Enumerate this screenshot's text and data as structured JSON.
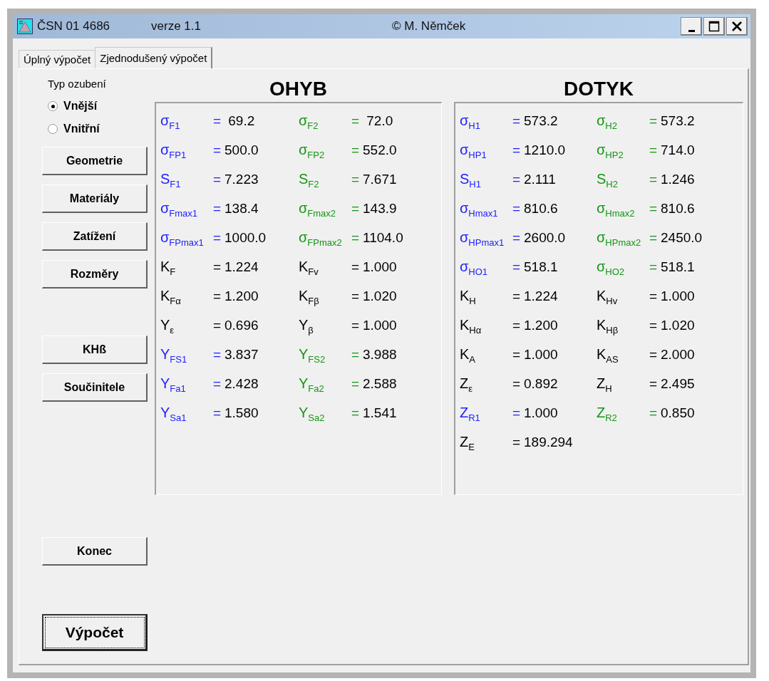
{
  "window": {
    "title": "ČSN 01 4686",
    "version": "verze 1.1",
    "author": "©  M. Němček"
  },
  "tabs": [
    {
      "label": "Úplný výpočet",
      "selected": false
    },
    {
      "label": "Zjednodušený výpočet",
      "selected": true
    }
  ],
  "gear_type": {
    "label": "Typ ozubení",
    "options": [
      {
        "label": "Vnější",
        "selected": true
      },
      {
        "label": "Vnitřní",
        "selected": false
      }
    ]
  },
  "buttons": [
    {
      "label": "Geometrie",
      "kind": "normal"
    },
    {
      "label": "Materiály",
      "kind": "normal"
    },
    {
      "label": "Zatížení",
      "kind": "normal"
    },
    {
      "label": "Rozměry",
      "kind": "normal"
    },
    {
      "label": "KHß",
      "kind": "gap"
    },
    {
      "label": "Součinitele",
      "kind": "normal"
    },
    {
      "label": "Konec",
      "kind": "far"
    },
    {
      "label": "Výpočet",
      "kind": "default"
    }
  ],
  "panels": [
    {
      "title": "OHYB",
      "rows": [
        {
          "left": {
            "label": "σ$_{F1}$",
            "eq": "=",
            "value": " 69.2",
            "color": "#2020ff"
          },
          "right": {
            "label": "σ$_{F2}$",
            "eq": "=",
            "value": " 72.0",
            "color": "#149614"
          }
        },
        {
          "left": {
            "label": "σ$_{FP1}$",
            "eq": "=",
            "value": "500.0",
            "color": "#2020ff"
          },
          "right": {
            "label": "σ$_{FP2}$",
            "eq": "=",
            "value": "552.0",
            "color": "#149614"
          }
        },
        {
          "left": {
            "label": "S$_{F1}$",
            "eq": "=",
            "value": "7.223",
            "color": "#2020ff"
          },
          "right": {
            "label": "S$_{F2}$",
            "eq": "=",
            "value": "7.671",
            "color": "#149614"
          }
        },
        {
          "left": {
            "label": "σ$_{Fmax1}$",
            "eq": "=",
            "value": "138.4",
            "color": "#2020ff"
          },
          "right": {
            "label": "σ$_{Fmax2}$",
            "eq": "=",
            "value": "143.9",
            "color": "#149614"
          }
        },
        {
          "left": {
            "label": "σ$_{FPmax1}$",
            "eq": "=",
            "value": "1000.0",
            "color": "#2020ff"
          },
          "right": {
            "label": "σ$_{FPmax2}$",
            "eq": "=",
            "value": "1104.0",
            "color": "#149614"
          }
        },
        {
          "left": {
            "label": "K$_{F}$",
            "eq": "=",
            "value": "1.224",
            "color": "#000000"
          },
          "right": {
            "label": "K$_{Fv}$",
            "eq": "=",
            "value": "1.000",
            "color": "#000000"
          }
        },
        {
          "left": {
            "label": "K$_{Fα}$",
            "eq": "=",
            "value": "1.200",
            "color": "#000000"
          },
          "right": {
            "label": "K$_{Fβ}$",
            "eq": "=",
            "value": "1.020",
            "color": "#000000"
          }
        },
        {
          "left": {
            "label": "Y$_{ε}$",
            "eq": "=",
            "value": "0.696",
            "color": "#000000"
          },
          "right": {
            "label": "Y$_{β}$",
            "eq": "=",
            "value": "1.000",
            "color": "#000000"
          }
        },
        {
          "left": {
            "label": "Y$_{FS1}$",
            "eq": "=",
            "value": "3.837",
            "color": "#2020ff"
          },
          "right": {
            "label": "Y$_{FS2}$",
            "eq": "=",
            "value": "3.988",
            "color": "#149614"
          }
        },
        {
          "left": {
            "label": "Y$_{Fa1}$",
            "eq": "=",
            "value": "2.428",
            "color": "#2020ff"
          },
          "right": {
            "label": "Y$_{Fa2}$",
            "eq": "=",
            "value": "2.588",
            "color": "#149614"
          }
        },
        {
          "left": {
            "label": "Y$_{Sa1}$",
            "eq": "=",
            "value": "1.580",
            "color": "#2020ff"
          },
          "right": {
            "label": "Y$_{Sa2}$",
            "eq": "=",
            "value": "1.541",
            "color": "#149614"
          }
        }
      ]
    },
    {
      "title": "DOTYK",
      "rows": [
        {
          "left": {
            "label": "σ$_{H1}$",
            "eq": "=",
            "value": "573.2",
            "color": "#2020ff"
          },
          "right": {
            "label": "σ$_{H2}$",
            "eq": "=",
            "value": "573.2",
            "color": "#149614"
          }
        },
        {
          "left": {
            "label": "σ$_{HP1}$",
            "eq": "=",
            "value": "1210.0",
            "color": "#2020ff"
          },
          "right": {
            "label": "σ$_{HP2}$",
            "eq": "=",
            "value": "714.0",
            "color": "#149614"
          }
        },
        {
          "left": {
            "label": "S$_{H1}$",
            "eq": "=",
            "value": "2.111",
            "color": "#2020ff"
          },
          "right": {
            "label": "S$_{H2}$",
            "eq": "=",
            "value": "1.246",
            "color": "#149614"
          }
        },
        {
          "left": {
            "label": "σ$_{Hmax1}$",
            "eq": "=",
            "value": "810.6",
            "color": "#2020ff"
          },
          "right": {
            "label": "σ$_{Hmax2}$",
            "eq": "=",
            "value": "810.6",
            "color": "#149614"
          }
        },
        {
          "left": {
            "label": "σ$_{HPmax1}$",
            "eq": "=",
            "value": "2600.0",
            "color": "#2020ff"
          },
          "right": {
            "label": "σ$_{HPmax2}$",
            "eq": "=",
            "value": "2450.0",
            "color": "#149614"
          }
        },
        {
          "left": {
            "label": "σ$_{HO1}$",
            "eq": "=",
            "value": "518.1",
            "color": "#2020ff"
          },
          "right": {
            "label": "σ$_{HO2}$",
            "eq": "=",
            "value": "518.1",
            "color": "#149614"
          }
        },
        {
          "left": {
            "label": "K$_{H}$",
            "eq": "=",
            "value": "1.224",
            "color": "#000000"
          },
          "right": {
            "label": "K$_{Hv}$",
            "eq": "=",
            "value": "1.000",
            "color": "#000000"
          }
        },
        {
          "left": {
            "label": "K$_{Hα}$",
            "eq": "=",
            "value": "1.200",
            "color": "#000000"
          },
          "right": {
            "label": "K$_{Hβ}$",
            "eq": "=",
            "value": "1.020",
            "color": "#000000"
          }
        },
        {
          "left": {
            "label": "K$_{A}$",
            "eq": "=",
            "value": "1.000",
            "color": "#000000"
          },
          "right": {
            "label": "K$_{AS}$",
            "eq": "=",
            "value": "2.000",
            "color": "#000000"
          }
        },
        {
          "left": {
            "label": "Z$_{ε}$",
            "eq": "=",
            "value": "0.892",
            "color": "#000000"
          },
          "right": {
            "label": "Z$_{H}$",
            "eq": "=",
            "value": "2.495",
            "color": "#000000"
          }
        },
        {
          "left": {
            "label": "Z$_{R1}$",
            "eq": "=",
            "value": "1.000",
            "color": "#2020ff"
          },
          "right": {
            "label": "Z$_{R2}$",
            "eq": "=",
            "value": "0.850",
            "color": "#149614"
          }
        },
        {
          "left": {
            "label": "Z$_{E}$",
            "eq": "=",
            "value": "189.294",
            "color": "#000000"
          }
        }
      ]
    }
  ]
}
